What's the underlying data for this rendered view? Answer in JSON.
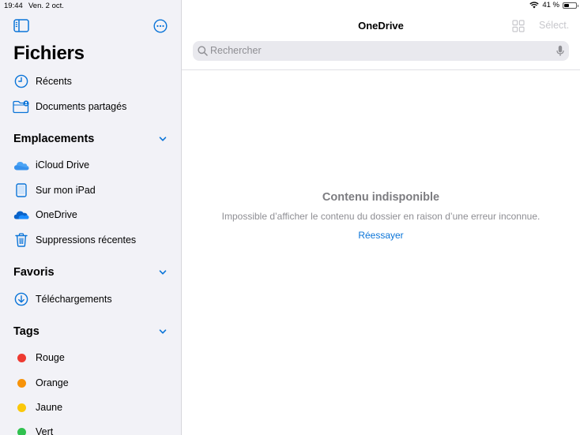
{
  "status_bar": {
    "time": "19:44",
    "date": "Ven. 2 oct.",
    "battery": "41 %",
    "battery_level": 0.41
  },
  "sidebar": {
    "title": "Fichiers",
    "quick": [
      {
        "label": "Récents",
        "icon": "clock-icon"
      },
      {
        "label": "Documents partagés",
        "icon": "shared-folder-icon"
      }
    ],
    "locations": {
      "header": "Emplacements",
      "items": [
        {
          "label": "iCloud Drive",
          "icon": "icloud-icon"
        },
        {
          "label": "Sur mon iPad",
          "icon": "ipad-icon"
        },
        {
          "label": "OneDrive",
          "icon": "onedrive-icon"
        },
        {
          "label": "Suppressions récentes",
          "icon": "trash-icon"
        }
      ]
    },
    "favorites": {
      "header": "Favoris",
      "items": [
        {
          "label": "Téléchargements",
          "icon": "download-icon"
        }
      ]
    },
    "tags": {
      "header": "Tags",
      "items": [
        {
          "label": "Rouge",
          "color": "#ee3a31"
        },
        {
          "label": "Orange",
          "color": "#f7930a"
        },
        {
          "label": "Jaune",
          "color": "#fbc80a"
        },
        {
          "label": "Vert",
          "color": "#30c14f"
        }
      ]
    }
  },
  "main": {
    "title": "OneDrive",
    "select_label": "Sélect.",
    "search_placeholder": "Rechercher",
    "empty_title": "Contenu indisponible",
    "empty_message": "Impossible d’afficher le contenu du dossier en raison d’une erreur inconnue.",
    "retry_label": "Réessayer"
  },
  "colors": {
    "accent": "#0a74d8",
    "sidebar_bg": "#f2f2f7"
  }
}
